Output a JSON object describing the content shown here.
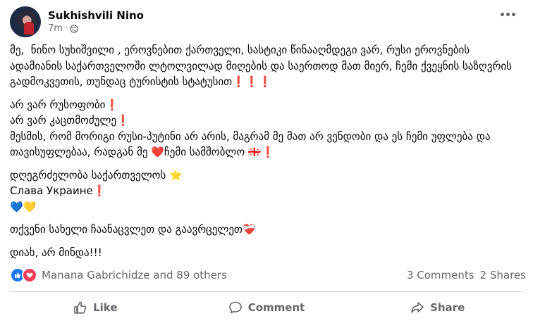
{
  "post": {
    "author": "Sukhishvili Nino",
    "time": "7m",
    "privacy_icon": "globe-icon",
    "paragraphs": [
      "მე,  ნინო სუხიშვილი , ეროვნებით ქართველი, სასტიკი წინააღმდეგი ვარ, რუსი ეროვნების ადამიანის საქართველოში ლტოლვილად მიღების და საერთოდ მათ მიერ, ჩემი ქვეყნის საზღვრის გადმოკვეთის, თუნდაც ტურისტის სტატუსით❗❗❗",
      "არ ვარ რუსოფობი❗\nარ ვარ კაცთმოძულე❗\nმესმის, რომ მორიგი რუსი-პუტინი არ არის, მაგრამ მე მათ არ ვენდობი და ეს ჩემი უფლება და თავისუფლებაა, რადგან მე ❤️ჩემი სამშობლო 🇬🇪❗",
      "დღეგრძელობა საქართველოს ⭐\nСлава Украине❗\n💙💛",
      "თქვენი სახელი ჩაანაცვლეთ და გაავრცელეთ❤️‍🩹",
      "დიახ, არ მინდა!!!"
    ]
  },
  "reactions": {
    "icons": [
      "like-icon",
      "love-icon"
    ],
    "summary": "Manana Gabrichidze and 89 others",
    "comments": "3 Comments",
    "shares": "2 Shares"
  },
  "actions": {
    "like": "Like",
    "comment": "Comment",
    "share": "Share"
  }
}
